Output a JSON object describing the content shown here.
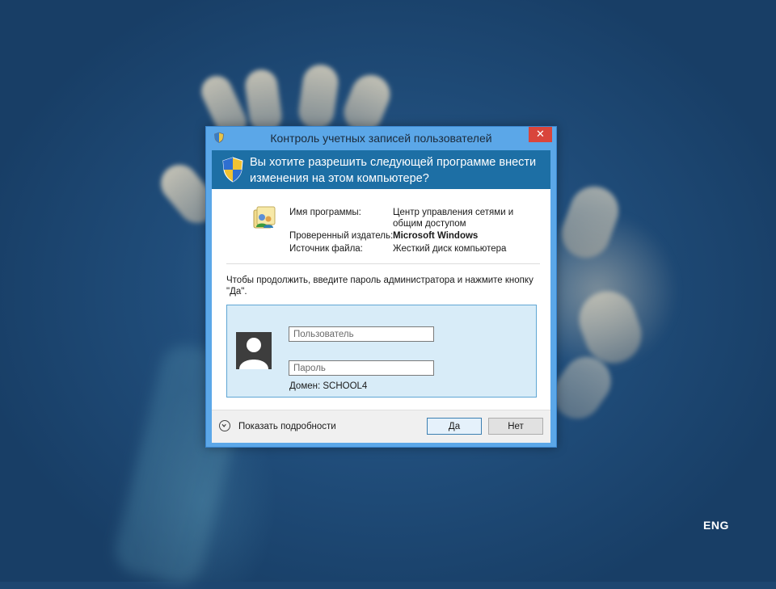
{
  "dialog": {
    "title": "Контроль учетных записей пользователей",
    "close_label": "✕",
    "question": "Вы хотите разрешить следующей программе внести изменения на этом компьютере?",
    "program_name_label": "Имя программы:",
    "program_name_value": "Центр управления сетями и общим доступом",
    "publisher_label": "Проверенный издатель:",
    "publisher_value": "Microsoft Windows",
    "file_source_label": "Источник файла:",
    "file_source_value": "Жесткий диск компьютера",
    "instruction": "Чтобы продолжить, введите пароль администратора и нажмите кнопку \"Да\".",
    "username_placeholder": "Пользователь",
    "password_placeholder": "Пароль",
    "domain_text": "Домен: SCHOOL4",
    "show_details_label": "Показать подробности",
    "yes_label": "Да",
    "no_label": "Нет"
  },
  "taskbar": {
    "language": "ENG"
  },
  "icons": {
    "title": "uac-shield-icon",
    "banner": "uac-shield-icon",
    "program": "network-sharing-center-icon",
    "avatar": "user-avatar-icon",
    "details": "chevron-down-icon"
  },
  "colors": {
    "frame": "#5ba7e8",
    "banner": "#1d6fa5",
    "close": "#d9453b",
    "credential_panel": "#d8ecf8"
  }
}
